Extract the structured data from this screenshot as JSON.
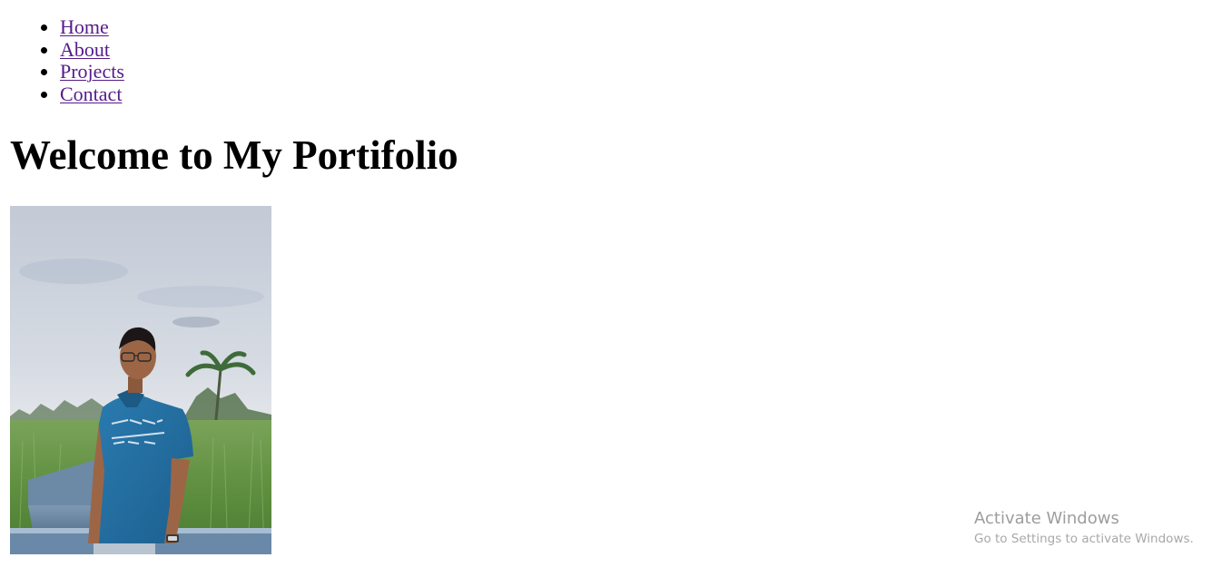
{
  "nav": {
    "items": [
      {
        "label": "Home"
      },
      {
        "label": "About"
      },
      {
        "label": "Projects"
      },
      {
        "label": "Contact"
      }
    ]
  },
  "heading": {
    "title": "Welcome to My Portifolio"
  },
  "photo": {
    "icon": "profile-photo"
  },
  "watermark": {
    "title": "Activate Windows",
    "subtitle": "Go to Settings to activate Windows."
  },
  "colors": {
    "link": "#551a8b",
    "text": "#000000",
    "background": "#ffffff",
    "watermark": "#a7a7a7"
  }
}
